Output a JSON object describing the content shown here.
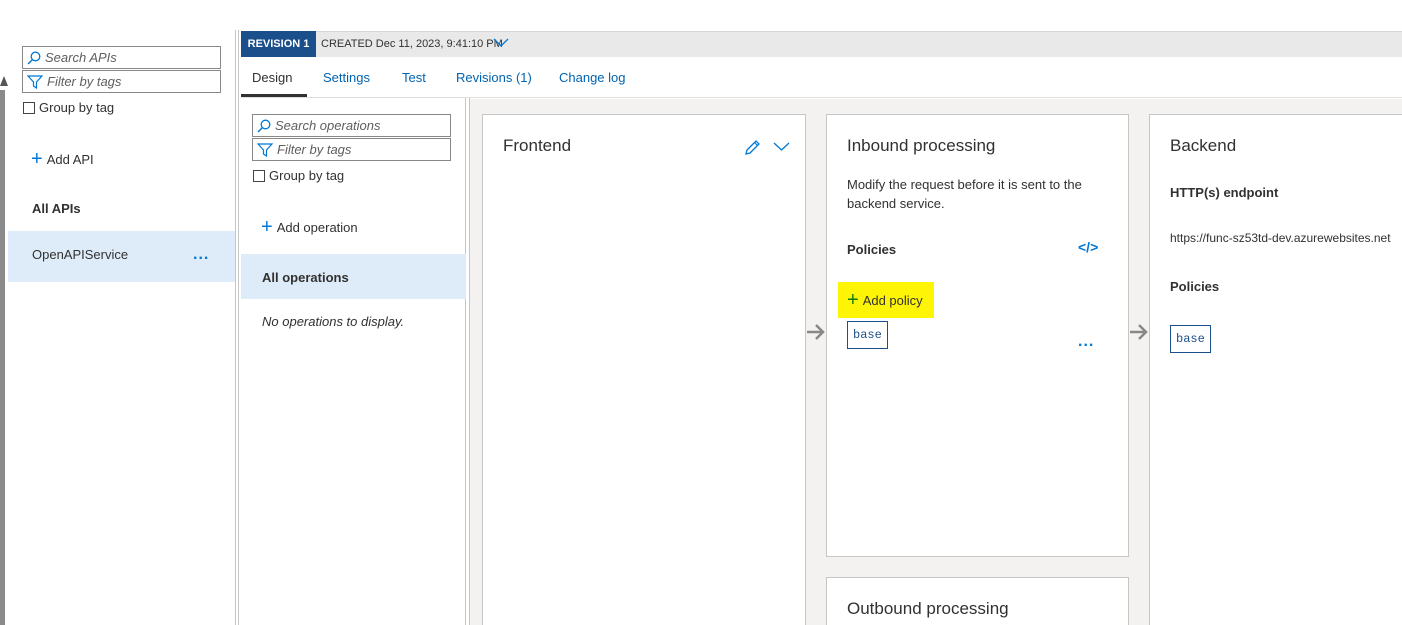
{
  "apis_panel": {
    "search_placeholder": "Search APIs",
    "filter_placeholder": "Filter by tags",
    "group_by_tag_label": "Group by tag",
    "add_api_label": "Add API",
    "all_apis_heading": "All APIs",
    "apis": [
      {
        "name": "OpenAPIService",
        "more_label": "..."
      }
    ]
  },
  "revision_bar": {
    "badge": "REVISION 1",
    "created": "CREATED Dec 11, 2023, 9:41:10 PM"
  },
  "tabs": [
    {
      "label": "Design",
      "active": true
    },
    {
      "label": "Settings",
      "active": false
    },
    {
      "label": "Test",
      "active": false
    },
    {
      "label": "Revisions (1)",
      "active": false
    },
    {
      "label": "Change log",
      "active": false
    }
  ],
  "operations_panel": {
    "search_placeholder": "Search operations",
    "filter_placeholder": "Filter by tags",
    "group_by_tag_label": "Group by tag",
    "add_operation_label": "Add operation",
    "all_operations_label": "All operations",
    "empty_message": "No operations to display."
  },
  "frontend_card": {
    "title": "Frontend"
  },
  "inbound_card": {
    "title": "Inbound processing",
    "description": "Modify the request before it is sent to the backend service.",
    "policies_heading": "Policies",
    "code_icon_label": "</>",
    "add_policy_label": "Add policy",
    "policy_chip": "base",
    "more_label": "..."
  },
  "backend_card": {
    "title": "Backend",
    "endpoint_heading": "HTTP(s) endpoint",
    "endpoint_url": "https://func-sz53td-dev.azurewebsites.net",
    "policies_heading": "Policies",
    "policy_chip": "base"
  },
  "outbound_card": {
    "title": "Outbound processing"
  },
  "colors": {
    "accent": "#0078d4",
    "revision_badge": "#1a4f8b",
    "selected_row": "#deecf9",
    "highlight": "#fdf505",
    "canvas_bg": "#f3f2f1"
  }
}
